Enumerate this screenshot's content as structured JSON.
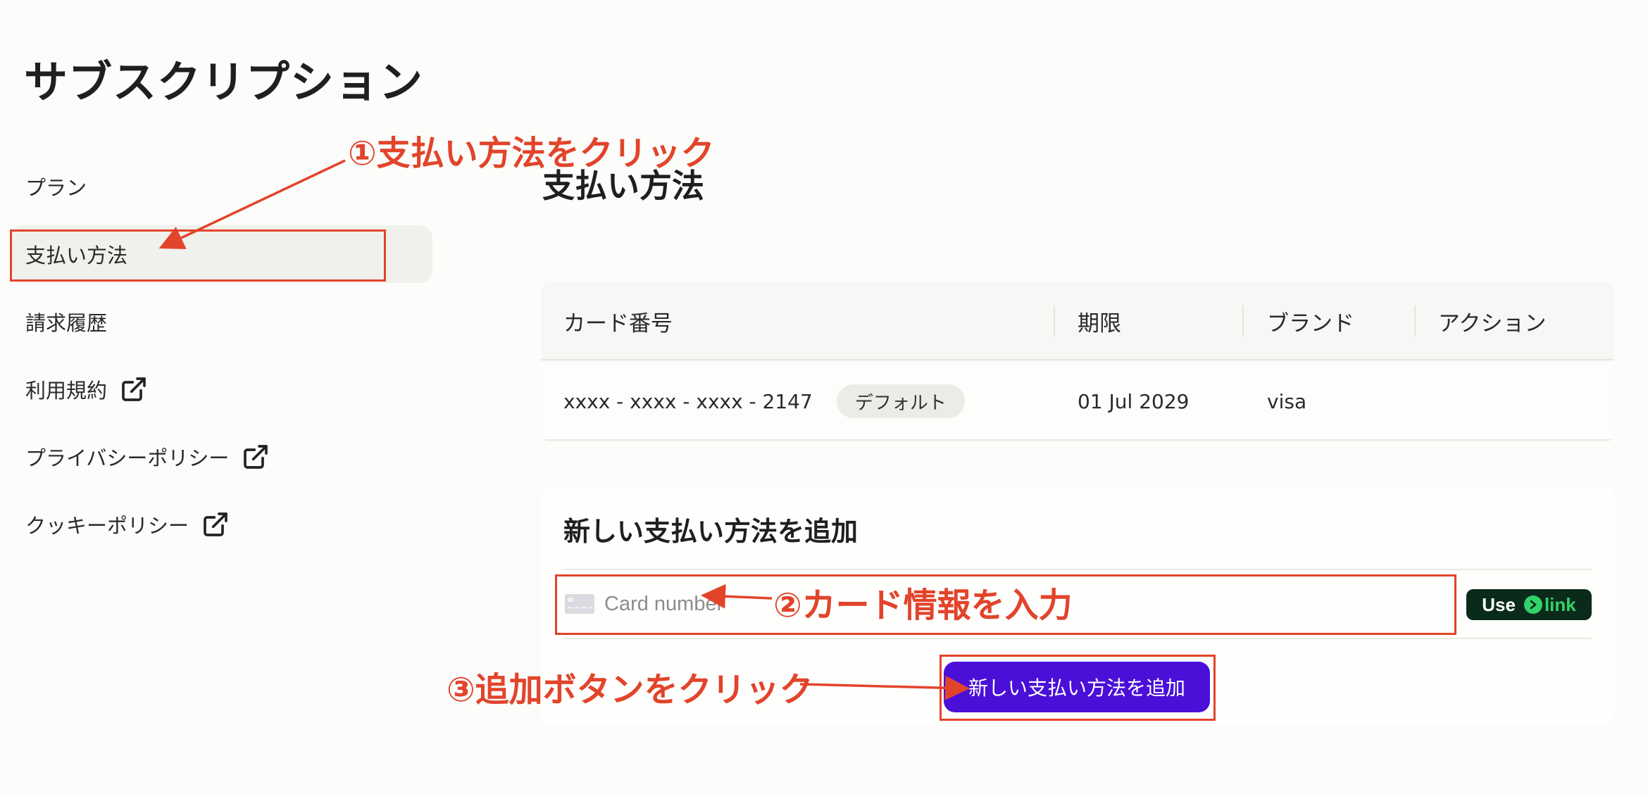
{
  "page_title": "サブスクリプション",
  "sidebar": {
    "items": [
      {
        "label": "プラン",
        "external": false
      },
      {
        "label": "支払い方法",
        "external": false,
        "active": true
      },
      {
        "label": "請求履歴",
        "external": false
      },
      {
        "label": "利用規約",
        "external": true
      },
      {
        "label": "プライバシーポリシー",
        "external": true
      },
      {
        "label": "クッキーポリシー",
        "external": true
      }
    ]
  },
  "main": {
    "section_title": "支払い方法",
    "table": {
      "columns": [
        "カード番号",
        "期限",
        "ブランド",
        "アクション"
      ],
      "rows": [
        {
          "card_number": "xxxx - xxxx - xxxx - 2147",
          "badge": "デフォルト",
          "expiry": "01 Jul 2029",
          "brand": "visa",
          "action": ""
        }
      ]
    },
    "add_panel": {
      "title": "新しい支払い方法を追加",
      "card_placeholder": "Card number",
      "link_button": {
        "use_label": "Use",
        "link_label": "link"
      },
      "submit_label": "新しい支払い方法を追加"
    }
  },
  "annotations": {
    "step1": "①支払い方法をクリック",
    "step2": "②カード情報を入力",
    "step3": "③追加ボタンをクリック"
  },
  "colors": {
    "accent": "#4a10d8",
    "annotation": "#e2442b",
    "link_green": "#33d26a",
    "link_bg": "#0b2b1a",
    "active_nav_bg": "#f0f0ed"
  }
}
